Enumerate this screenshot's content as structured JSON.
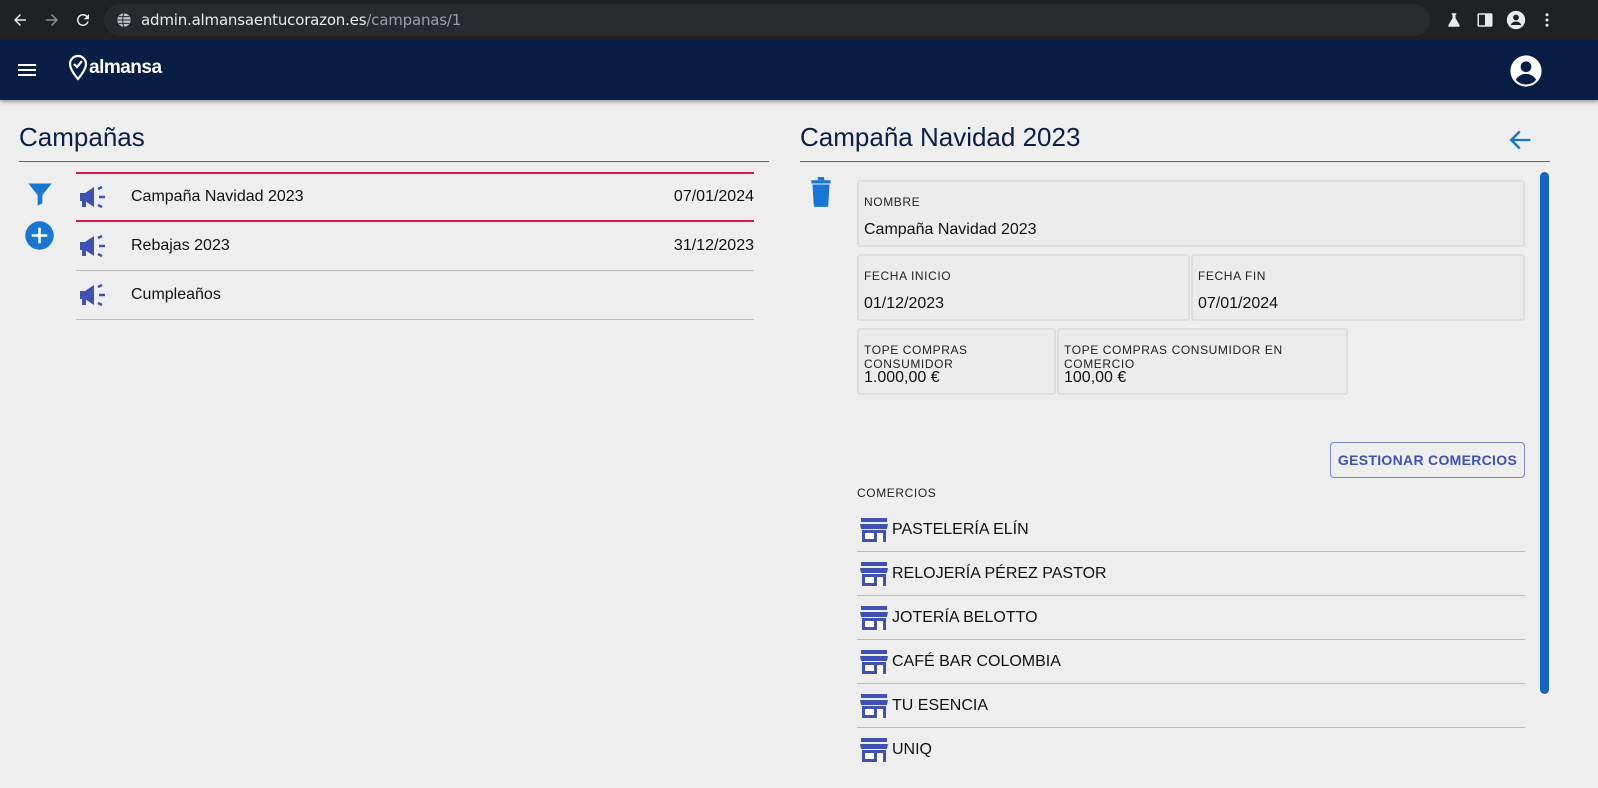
{
  "browser": {
    "url_host": "admin.almansaentucorazon.es",
    "url_path": "/campanas/1"
  },
  "appbar": {
    "logo_text": "almansa"
  },
  "left": {
    "title": "Campañas",
    "campaigns": [
      {
        "name": "Campaña Navidad 2023",
        "date": "07/01/2024",
        "selected": true
      },
      {
        "name": "Rebajas 2023",
        "date": "31/12/2023",
        "selected": false
      },
      {
        "name": "Cumpleaños",
        "date": "",
        "selected": false
      }
    ]
  },
  "detail": {
    "title": "Campaña Navidad 2023",
    "fields": {
      "nombre": {
        "label": "NOMBRE",
        "value": "Campaña Navidad 2023"
      },
      "fecha_inicio": {
        "label": "FECHA INICIO",
        "value": "01/12/2023"
      },
      "fecha_fin": {
        "label": "FECHA FIN",
        "value": "07/01/2024"
      },
      "tope_consumidor": {
        "label": "TOPE COMPRAS CONSUMIDOR",
        "value": "1.000,00 €"
      },
      "tope_comercio": {
        "label": "TOPE COMPRAS CONSUMIDOR EN COMERCIO",
        "value": "100,00 €"
      }
    },
    "manage_button": "GESTIONAR COMERCIOS",
    "comercios_label": "COMERCIOS",
    "comercios": [
      "PASTELERÍA ELÍN",
      "RELOJERÍA PÉREZ PASTOR",
      "JOTERÍA BELOTTO",
      "CAFÉ BAR COLOMBIA",
      "TU ESENCIA",
      "UNIQ"
    ]
  },
  "colors": {
    "appbar": "#081e44",
    "accent_blue": "#1976d2",
    "icon_indigo": "#3f51b5",
    "selected_border": "#d81b60"
  }
}
